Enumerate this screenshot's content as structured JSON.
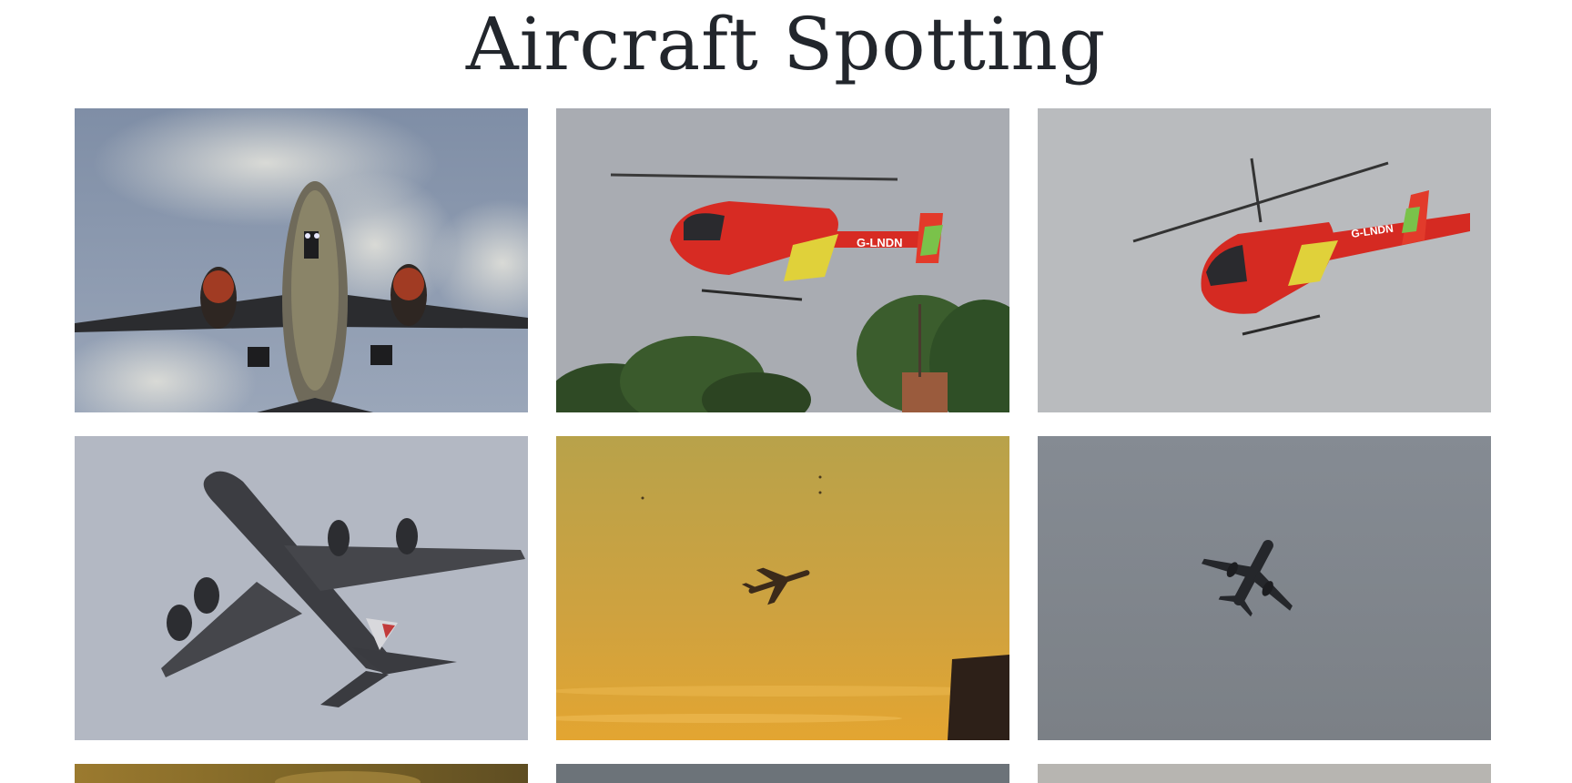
{
  "page": {
    "title": "Aircraft Spotting"
  },
  "gallery": {
    "photos": [
      {
        "subject": "airliner-landing",
        "icon": "airliner-underside-icon",
        "sky": "#8e9bb0"
      },
      {
        "subject": "red-helicopter-over-trees",
        "icon": "helicopter-icon",
        "sky": "#a8acb2",
        "reg_marking": "G-LNDN"
      },
      {
        "subject": "red-helicopter-banking",
        "icon": "helicopter-icon",
        "sky": "#b8babd",
        "reg_marking": "G-LNDN"
      },
      {
        "subject": "a380-climbing",
        "icon": "four-engine-jet-icon",
        "sky": "#b4b9c4"
      },
      {
        "subject": "jet-in-golden-sky",
        "icon": "small-jet-silhouette-icon",
        "sky": "#c49a3c"
      },
      {
        "subject": "twin-jet-grey-sky",
        "icon": "small-jet-silhouette-icon",
        "sky": "#8b8f95"
      },
      {
        "subject": "sunset-sky",
        "icon": "photo-icon",
        "sky": "#8a6f2e"
      },
      {
        "subject": "grey-sky",
        "icon": "photo-icon",
        "sky": "#6f767c"
      },
      {
        "subject": "pale-sky",
        "icon": "photo-icon",
        "sky": "#b9b7b3"
      }
    ]
  }
}
